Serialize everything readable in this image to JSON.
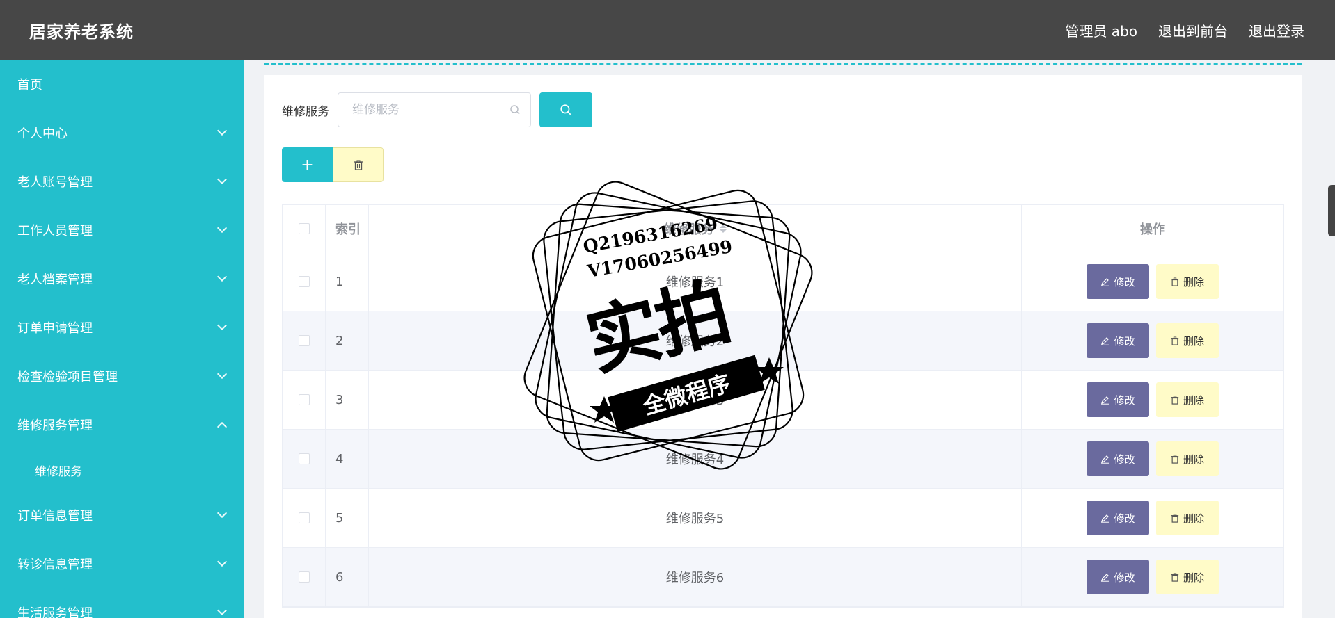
{
  "header": {
    "title": "居家养老系统",
    "admin": "管理员 abo",
    "frontend": "退出到前台",
    "logout": "退出登录"
  },
  "sidebar": {
    "items": [
      {
        "label": "首页"
      },
      {
        "label": "个人中心"
      },
      {
        "label": "老人账号管理"
      },
      {
        "label": "工作人员管理"
      },
      {
        "label": "老人档案管理"
      },
      {
        "label": "订单申请管理"
      },
      {
        "label": "检查检验项目管理"
      },
      {
        "label": "维修服务管理"
      },
      {
        "label": "维修服务"
      },
      {
        "label": "订单信息管理"
      },
      {
        "label": "转诊信息管理"
      },
      {
        "label": "生活服务管理"
      }
    ]
  },
  "search": {
    "label": "维修服务",
    "placeholder": "维修服务"
  },
  "table": {
    "headers": {
      "index": "索引",
      "name": "维修服务",
      "ops": "操作"
    },
    "rows": [
      {
        "index": "1",
        "name": "维修服务1"
      },
      {
        "index": "2",
        "name": "维修服务2"
      },
      {
        "index": "3",
        "name": "维修服务3"
      },
      {
        "index": "4",
        "name": "维修服务4"
      },
      {
        "index": "5",
        "name": "维修服务5"
      },
      {
        "index": "6",
        "name": "维修服务6"
      }
    ],
    "edit_label": "修改",
    "delete_label": "删除"
  },
  "watermark": {
    "line1": "Q2196316269",
    "line2": "V17060256499",
    "big": "实拍",
    "ribbon": "全微程序"
  },
  "colors": {
    "header_bg": "#474747",
    "sidebar_bg": "#23bfcc",
    "accent": "#23bfcc",
    "edit_btn": "#6a6a9e",
    "delete_btn": "#fffbc8"
  }
}
